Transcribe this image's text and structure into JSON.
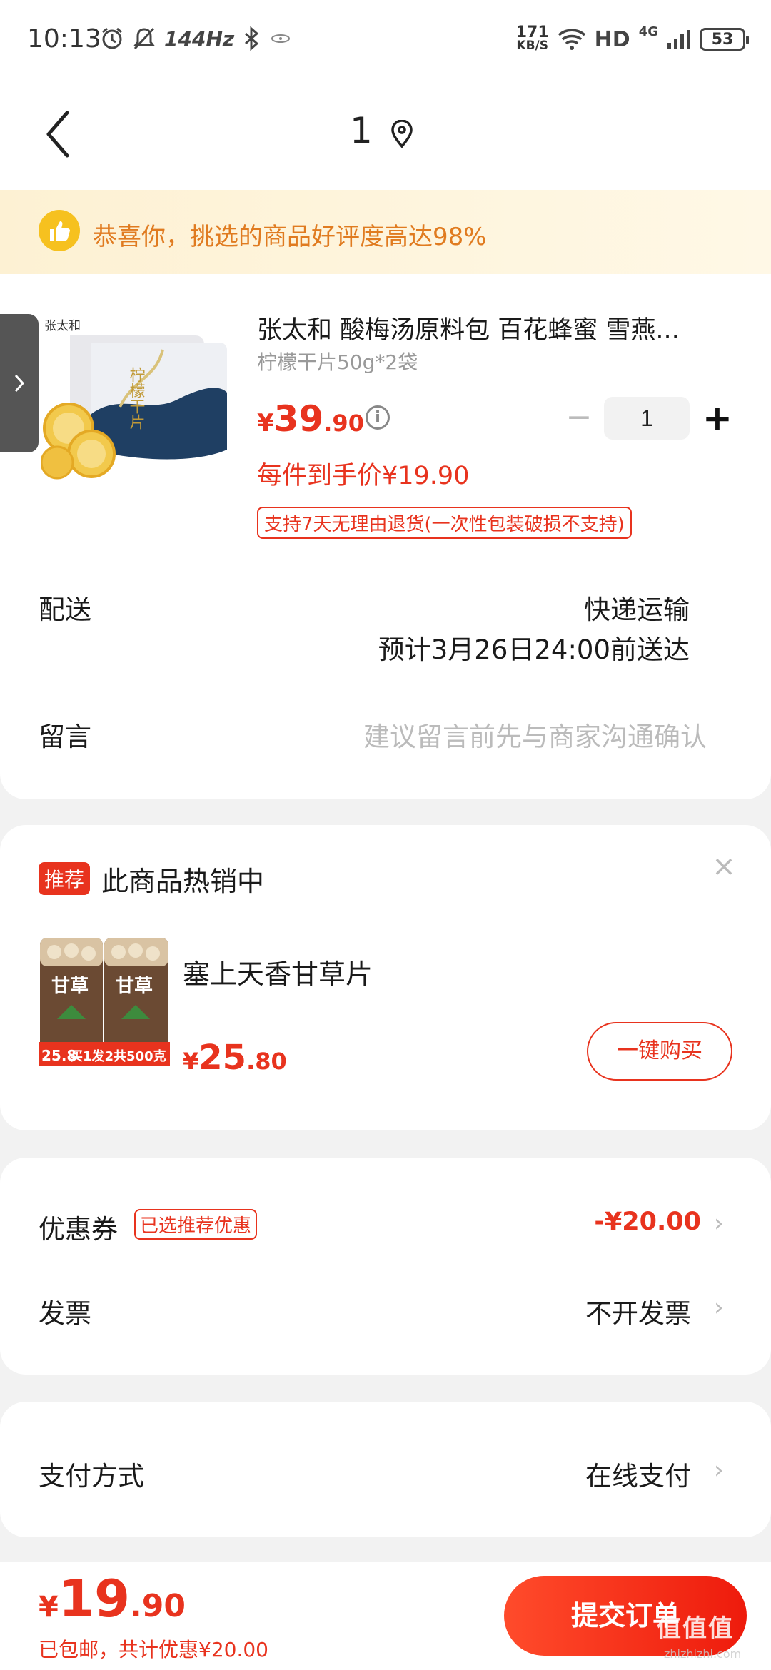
{
  "status_bar": {
    "time": "10:13",
    "refresh_rate": "144Hz",
    "net_speed_top": "171",
    "net_speed_bottom": "KB/S",
    "hd": "HD",
    "network": "4G",
    "battery": "53",
    "icons": [
      "alarm-icon",
      "mute-icon",
      "bluetooth-icon",
      "nfc-icon",
      "wifi-icon",
      "signal-icon"
    ]
  },
  "header": {
    "title": "1",
    "back_icon": "chevron-left-icon",
    "location_icon": "location-pin-icon"
  },
  "banner": {
    "icon": "thumbs-up-icon",
    "text": "恭喜你，挑选的商品好评度高达98%"
  },
  "product": {
    "brand_logo": "张太和",
    "package_text": "柠檬干片",
    "title": "张太和 酸梅汤原料包 百花蜂蜜 雪燕...",
    "spec": "柠檬干片50g*2袋",
    "price_symbol": "¥",
    "price_int": "39",
    "price_dec": ".90",
    "unit_price": "每件到手价¥19.90",
    "return_policy": "支持7天无理由退货(一次性包装破损不支持)",
    "quantity": "1",
    "minus": "−",
    "plus": "+"
  },
  "delivery": {
    "label": "配送",
    "method": "快递运输",
    "eta": "预计3月26日24:00前送达"
  },
  "message": {
    "label": "留言",
    "placeholder": "建议留言前先与商家沟通确认"
  },
  "recommend": {
    "badge": "推荐",
    "title": "此商品热销中",
    "item_name": "塞上天香甘草片",
    "image_label": "甘草",
    "image_promo_price": "25.8",
    "image_promo": "买1发2共500克",
    "price_symbol": "¥",
    "price_int": "25",
    "price_dec": ".80",
    "buy_label": "一键购买"
  },
  "coupon": {
    "label": "优惠券",
    "tag": "已选推荐优惠",
    "value": "-¥20.00"
  },
  "invoice": {
    "label": "发票",
    "value": "不开发票"
  },
  "payment": {
    "label": "支付方式",
    "value": "在线支付"
  },
  "footer": {
    "price_symbol": "¥",
    "price_int": "19",
    "price_dec": ".90",
    "summary": "已包邮，共计优惠¥20.00",
    "submit_label": "提交订单",
    "watermark": "值值值",
    "watermark_sub": "zhizhizhi.com"
  },
  "colors": {
    "accent": "#e8331e",
    "banner_text": "#e07b20",
    "banner_bg": "#fdf1d3"
  }
}
